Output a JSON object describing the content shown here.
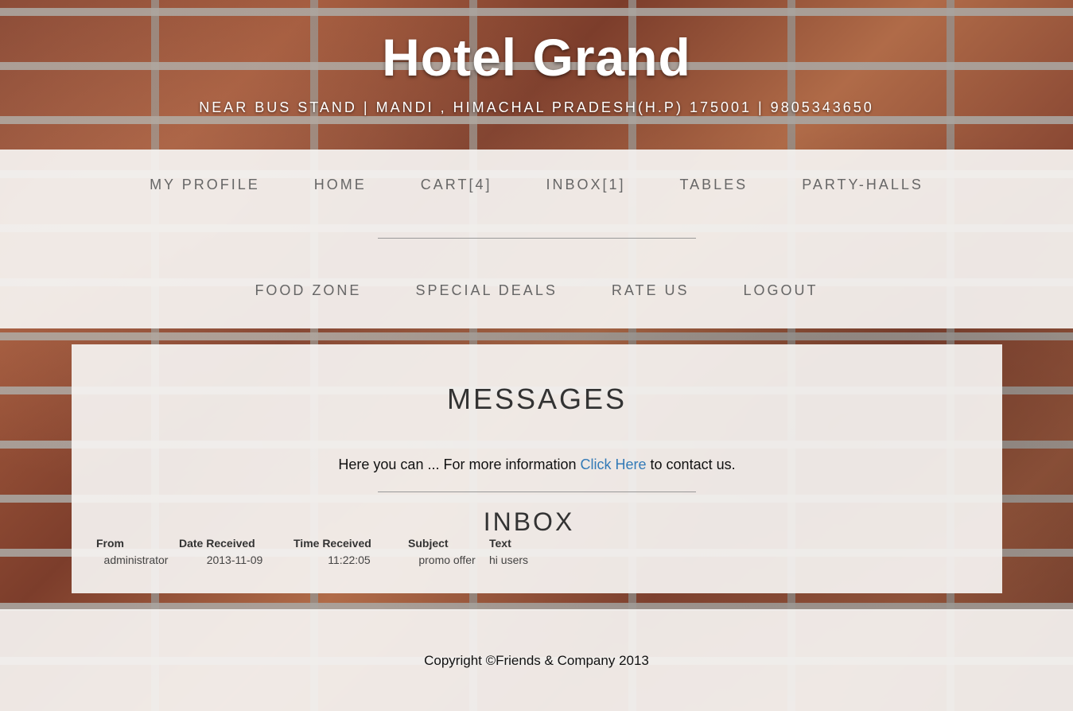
{
  "header": {
    "title": "Hotel Grand",
    "address": "NEAR BUS STAND | MANDI , HIMACHAL PRADESH(H.P) 175001 | 9805343650"
  },
  "nav": {
    "row1": [
      {
        "label": "MY PROFILE"
      },
      {
        "label": "HOME"
      },
      {
        "label": "CART[4]"
      },
      {
        "label": "INBOX[1]"
      },
      {
        "label": "TABLES"
      },
      {
        "label": "PARTY-HALLS"
      }
    ],
    "row2": [
      {
        "label": "FOOD ZONE"
      },
      {
        "label": "SPECIAL DEALS"
      },
      {
        "label": "RATE US"
      },
      {
        "label": "LOGOUT"
      }
    ]
  },
  "main": {
    "messages_title": "MESSAGES",
    "intro_before": "Here you can ... For more information ",
    "intro_link": "Click Here",
    "intro_after": " to contact us.",
    "inbox_title": "INBOX",
    "table": {
      "headers": [
        "From",
        "Date Received",
        "Time Received",
        "Subject",
        "Text"
      ],
      "rows": [
        [
          "administrator",
          "2013-11-09",
          "11:22:05",
          "promo offer",
          "hi users"
        ]
      ]
    }
  },
  "footer": {
    "copyright": "Copyright ©Friends & Company 2013"
  }
}
